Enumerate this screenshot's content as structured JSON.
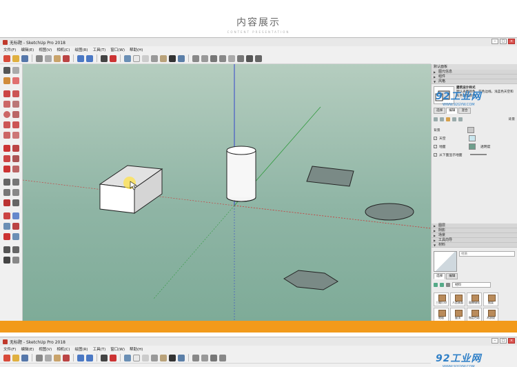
{
  "heading": {
    "title": "内容展示",
    "subtitle": "CONTENT PRESENTATION"
  },
  "window": {
    "title": "无标题 - SketchUp Pro 2018",
    "controls": [
      "–",
      "□",
      "×"
    ]
  },
  "menu": [
    "文件(F)",
    "编辑(E)",
    "视图(V)",
    "相机(C)",
    "绘图(R)",
    "工具(T)",
    "窗口(W)",
    "帮助(H)"
  ],
  "watermark": {
    "logo": "92工业网",
    "url": "WWW.92GYW.COM"
  },
  "panel": {
    "title": "默认面板",
    "trays_top": [
      "图元信息",
      "组件",
      "风格"
    ],
    "style": {
      "name": "建筑设计样式",
      "description": "默认表面颜色，蓝色边线，浅蓝色天空和灰色背景颜色"
    },
    "tabs": [
      "选择",
      "编辑",
      "混合"
    ],
    "bg_section": "背景",
    "bg_rows": [
      {
        "label": "背景",
        "checked": false,
        "color": "#c8c8c8"
      },
      {
        "label": "天空",
        "checked": true,
        "color": "#c9e6ee"
      },
      {
        "label": "地面",
        "checked": true,
        "color": "#6f9f8d"
      },
      {
        "label": "从下面显示地面",
        "checked": true,
        "color": ""
      }
    ],
    "transparency_label": "透明度",
    "trays_bottom": [
      "图层",
      "阴影",
      "场景",
      "工具向导",
      "材料"
    ],
    "material": {
      "name_placeholder": "材质",
      "tabs": [
        "选择",
        "编辑"
      ],
      "dropdown": "材料",
      "items": [
        "三维打印",
        "人造表面",
        "园林绿化",
        "图案",
        "地毯",
        "屋顶",
        "指定色彩",
        "木质纹"
      ]
    }
  },
  "window2": {
    "title": "无标题 - SketchUp Pro 2018"
  },
  "colors": {
    "orange_bar": "#f29a1a",
    "viewport_sky": "#b5cdbf",
    "viewport_ground": "#7eab98"
  }
}
